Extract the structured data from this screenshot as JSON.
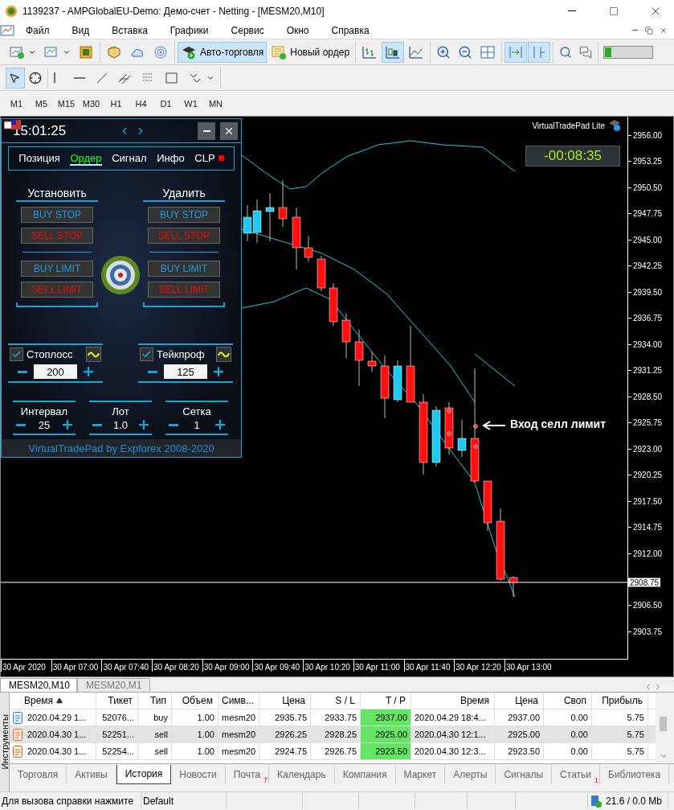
{
  "window": {
    "title": "1139237 - AMPGlobalEU-Demo: Демо-счет - Netting - [MESM20,M10]"
  },
  "menu": [
    "Файл",
    "Вид",
    "Вставка",
    "Графики",
    "Сервис",
    "Окно",
    "Справка"
  ],
  "toolbar": [
    [
      {
        "pressed": false
      },
      {
        "pressed": false
      },
      {
        "pressed": false
      }
    ],
    [
      {
        "pressed": false
      },
      {
        "pressed": false
      },
      {
        "pressed": false
      }
    ],
    [
      {
        "label": "Авто-торговля",
        "pressed": true
      },
      {
        "label": "Новый ордер",
        "pressed": false
      }
    ],
    [
      {
        "pressed": false
      },
      {
        "pressed": true
      },
      {
        "pressed": false
      }
    ],
    [
      {
        "pressed": false
      },
      {
        "pressed": false
      },
      {
        "pressed": false
      }
    ],
    [
      {
        "pressed": true
      },
      {
        "pressed": true
      }
    ],
    [
      {
        "pressed": false
      },
      {
        "pressed": false
      }
    ]
  ],
  "drawing_tools": [
    [
      {
        "pressed": true
      },
      {
        "pressed": false
      }
    ],
    [
      {
        "pressed": false
      },
      {
        "pressed": false
      },
      {
        "pressed": false
      },
      {
        "pressed": false
      },
      {
        "pressed": false
      },
      {
        "pressed": false
      },
      {
        "pressed": false
      }
    ]
  ],
  "timeframes": [
    "M1",
    "M5",
    "M15",
    "M30",
    "H1",
    "H4",
    "D1",
    "W1",
    "MN"
  ],
  "chart": {
    "badge": "VirtualTradePad  Lite",
    "countdown": "-00:08:35",
    "annotation": "Вход селл лимит",
    "price_ticks_above": [
      "2956.00",
      "2953.25",
      "2950.50",
      "2947.75",
      "2945.00",
      "2942.25",
      "2939.50",
      "2936.75",
      "2934.00",
      "2931.25",
      "2928.50",
      "2925.75",
      "2923.00",
      "2920.25",
      "2917.50",
      "2914.75",
      "2912.00"
    ],
    "price_ticks_below": [
      "2906.50",
      "2903.75"
    ],
    "current_price": "2908.75",
    "time_ticks": [
      "30 Apr 2020",
      "30 Apr 07:00",
      "30 Apr 07:40",
      "30 Apr 08:20",
      "30 Apr 09:00",
      "30 Apr 09:40",
      "30 Apr 10:20",
      "30 Apr 11:00",
      "30 Apr 11:40",
      "30 Apr 12:20",
      "30 Apr 13:00"
    ]
  },
  "trade_pad": {
    "clock": "15:01:25",
    "tabs": [
      {
        "label": "Позиция",
        "selected": false
      },
      {
        "label": "Ордер",
        "selected": true
      },
      {
        "label": "Сигнал",
        "selected": false
      },
      {
        "label": "Инфо",
        "selected": false
      },
      {
        "label": "CLP",
        "selected": false,
        "color": "#ff0000"
      }
    ],
    "order_groups": [
      {
        "title": "Установить",
        "buttons": [
          {
            "label": "BUY STOP",
            "kind": "buy"
          },
          {
            "label": "SELL STOP",
            "kind": "sell"
          },
          {
            "label": "BUY LIMIT",
            "kind": "buy"
          },
          {
            "label": "SELL LIMIT",
            "kind": "sell"
          }
        ]
      },
      {
        "title": "Удалить",
        "buttons": [
          {
            "label": "BUY STOP",
            "kind": "buy"
          },
          {
            "label": "SELL STOP",
            "kind": "sell"
          },
          {
            "label": "BUY LIMIT",
            "kind": "buy"
          },
          {
            "label": "SELL LIMIT",
            "kind": "sell"
          }
        ]
      }
    ],
    "protection": [
      {
        "label": "Стоплосс",
        "checked": true,
        "value": "200"
      },
      {
        "label": "Тейкпроф",
        "checked": true,
        "value": "125"
      }
    ],
    "steppers": [
      {
        "label": "Интервал",
        "value": "25"
      },
      {
        "label": "Лот",
        "value": "1.0"
      },
      {
        "label": "Сетка",
        "value": "1"
      }
    ],
    "footer": "VirtualTradePad by Expforex 2008-2020"
  },
  "chart_tabs": [
    {
      "label": "MESM20,M10",
      "selected": true
    },
    {
      "label": "MESM20,M1",
      "selected": false
    }
  ],
  "terminal": {
    "side_label": "Инструменты",
    "columns": [
      {
        "label": "Время",
        "sorted": true
      },
      {
        "label": "Тикет",
        "sorted": false
      },
      {
        "label": "Тип",
        "sorted": false
      },
      {
        "label": "Объем",
        "sorted": false
      },
      {
        "label": "Симв...",
        "sorted": false
      },
      {
        "label": "Цена",
        "sorted": false
      },
      {
        "label": "S / L",
        "sorted": false
      },
      {
        "label": "T / P",
        "sorted": false
      },
      {
        "label": "Время",
        "sorted": false
      },
      {
        "label": "Цена",
        "sorted": false
      },
      {
        "label": "Своп",
        "sorted": false
      },
      {
        "label": "Прибыль",
        "sorted": false
      }
    ],
    "rows": [
      {
        "kind": "buy",
        "selected": false,
        "cells": [
          "2020.04.29 1...",
          "52076...",
          "buy",
          "1.00",
          "mesm20",
          "2935.75",
          "2933.75",
          "2937.00",
          "2020.04.29 18:4...",
          "2937.00",
          "0.00",
          "5.75"
        ]
      },
      {
        "kind": "sell",
        "selected": true,
        "cells": [
          "2020.04.30 1...",
          "52251...",
          "sell",
          "1.00",
          "mesm20",
          "2926.25",
          "2928.25",
          "2925.00",
          "2020.04.30 12:1...",
          "2925.00",
          "0.00",
          "5.75"
        ]
      },
      {
        "kind": "sell",
        "selected": false,
        "cells": [
          "2020.04.30 1...",
          "52254...",
          "sell",
          "1.00",
          "mesm20",
          "2924.75",
          "2926.75",
          "2923.50",
          "2020.04.30 12:3...",
          "2923.50",
          "0.00",
          "5.75"
        ]
      }
    ],
    "tabs": [
      {
        "label": "Торговля",
        "selected": false
      },
      {
        "label": "Активы",
        "selected": false
      },
      {
        "label": "История",
        "selected": true
      },
      {
        "label": "Новости",
        "selected": false
      },
      {
        "label": "Почта",
        "selected": false,
        "badge": "7"
      },
      {
        "label": "Календарь",
        "selected": false
      },
      {
        "label": "Компания",
        "selected": false
      },
      {
        "label": "Маркет",
        "selected": false
      },
      {
        "label": "Алерты",
        "selected": false
      },
      {
        "label": "Сигналы",
        "selected": false
      },
      {
        "label": "Статьи",
        "selected": false,
        "badge": "1"
      },
      {
        "label": "Библиотека",
        "selected": false
      }
    ]
  },
  "status_bar": {
    "help": "Для вызова справки нажмите",
    "profile": "Default",
    "memory": "21.6 / 0.0 Mb"
  }
}
